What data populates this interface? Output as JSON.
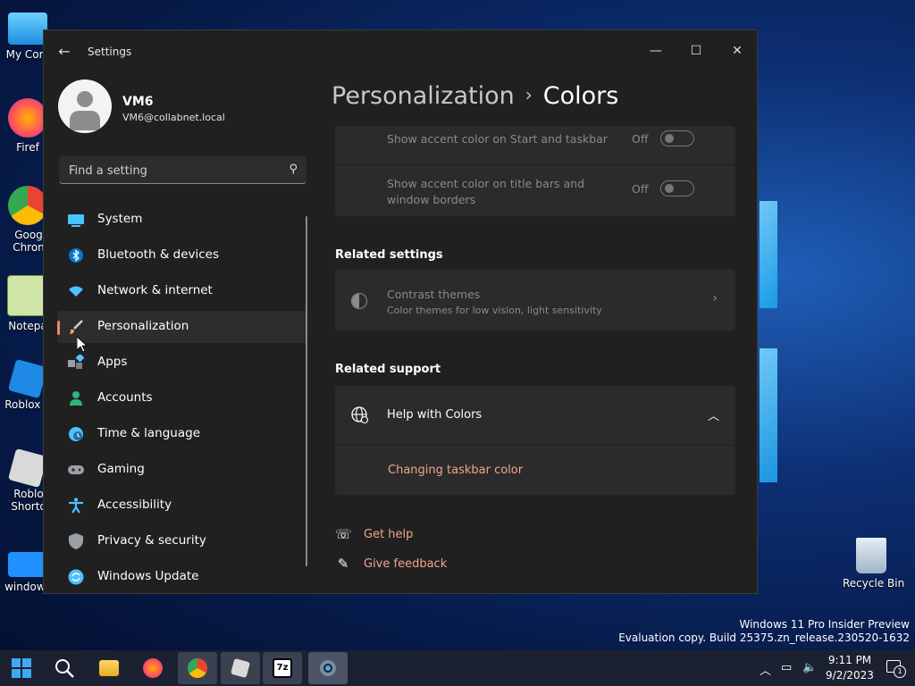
{
  "desktop": {
    "icons": [
      {
        "label": "My Com",
        "color": "#3aa8e8"
      },
      {
        "label": "Firef",
        "color": "#ff7139"
      },
      {
        "label": "Goog Chron",
        "color": "#4285f4"
      },
      {
        "label": "Notepa",
        "color": "#7bbf3a"
      },
      {
        "label": "Roblox S",
        "color": "#3a8ee8"
      },
      {
        "label": "Roblo Shorto",
        "color": "#d0d0d0"
      },
      {
        "label": "windows",
        "color": "#1e90ff"
      }
    ],
    "recycle_bin": "Recycle Bin",
    "watermark": {
      "line1": "Windows 11 Pro Insider Preview",
      "line2": "Evaluation copy. Build 25375.zn_release.230520-1632"
    }
  },
  "window": {
    "title": "Settings",
    "controls": {
      "minimize": "—",
      "maximize": "☐",
      "close": "✕"
    },
    "user": {
      "name": "VM6",
      "email": "VM6@collabnet.local"
    },
    "search": {
      "placeholder": "Find a setting"
    },
    "nav": [
      {
        "label": "System",
        "icon": "system-icon",
        "color": "#4cc2ff",
        "active": false
      },
      {
        "label": "Bluetooth & devices",
        "icon": "bluetooth-icon",
        "color": "#0078d4",
        "active": false
      },
      {
        "label": "Network & internet",
        "icon": "wifi-icon",
        "color": "#4cc2ff",
        "active": false
      },
      {
        "label": "Personalization",
        "icon": "brush-icon",
        "color": "#e8a070",
        "active": true
      },
      {
        "label": "Apps",
        "icon": "apps-icon",
        "color": "#9aa0a6",
        "active": false
      },
      {
        "label": "Accounts",
        "icon": "accounts-icon",
        "color": "#2fb67c",
        "active": false
      },
      {
        "label": "Time & language",
        "icon": "clock-globe-icon",
        "color": "#4cc2ff",
        "active": false
      },
      {
        "label": "Gaming",
        "icon": "gamepad-icon",
        "color": "#9aa0a6",
        "active": false
      },
      {
        "label": "Accessibility",
        "icon": "accessibility-icon",
        "color": "#4cc2ff",
        "active": false
      },
      {
        "label": "Privacy & security",
        "icon": "shield-icon",
        "color": "#9aa0a6",
        "active": false
      },
      {
        "label": "Windows Update",
        "icon": "update-icon",
        "color": "#4cc2ff",
        "active": false
      }
    ],
    "breadcrumb": {
      "parent": "Personalization",
      "separator": "›",
      "current": "Colors"
    },
    "accent_settings": [
      {
        "label": "Show accent color on Start and taskbar",
        "state": "Off"
      },
      {
        "label": "Show accent color on title bars and window borders",
        "state": "Off"
      }
    ],
    "related_settings": {
      "heading": "Related settings",
      "contrast": {
        "title": "Contrast themes",
        "subtitle": "Color themes for low vision, light sensitivity"
      }
    },
    "related_support": {
      "heading": "Related support",
      "help_title": "Help with Colors",
      "help_link": "Changing taskbar color"
    },
    "links": {
      "get_help": "Get help",
      "give_feedback": "Give feedback"
    }
  },
  "taskbar": {
    "time": "9:11 PM",
    "date": "9/2/2023",
    "notification_count": "1",
    "apps": [
      "start-icon",
      "search-icon",
      "file-explorer-icon",
      "firefox-icon",
      "chrome-icon",
      "roblox-icon",
      "7zip-icon",
      "settings-icon"
    ]
  },
  "colors": {
    "accent": "#f0a58b",
    "window_bg": "#202020",
    "card_bg": "#2b2b2b"
  }
}
